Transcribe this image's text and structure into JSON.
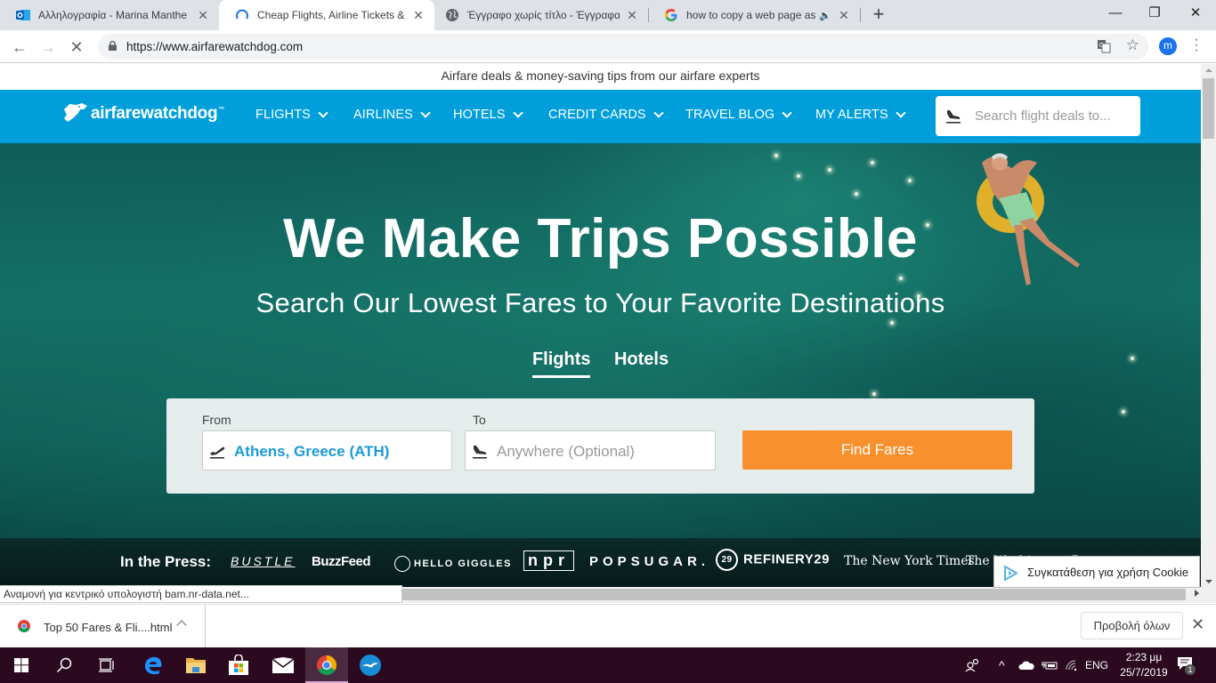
{
  "browser": {
    "tabs": [
      {
        "title": "Αλληλογραφία - Marina Manthe",
        "icon": "outlook-icon",
        "active": false
      },
      {
        "title": "Cheap Flights, Airline Tickets & D",
        "icon": "loading-spinner-icon",
        "active": true
      },
      {
        "title": "Έγγραφο χωρίς τίτλο - Έγγραφα",
        "icon": "globe-icon",
        "active": false
      },
      {
        "title": "how to copy a web page as a",
        "icon": "google-icon",
        "active": false,
        "audio": true
      }
    ],
    "new_tab_label": "+",
    "window_controls": {
      "minimize": "—",
      "restore": "❐",
      "close": "✕"
    },
    "url": "https://www.airfarewatchdog.com",
    "profile_initial": "m",
    "status_text": "Αναμονή για κεντρικό υπολογιστή bam.nr-data.net..."
  },
  "site": {
    "top_banner": "Airfare deals & money-saving tips from our airfare experts",
    "logo_text": "airfarewatchdog",
    "logo_tm": "™",
    "nav": [
      {
        "label": "FLIGHTS"
      },
      {
        "label": "AIRLINES"
      },
      {
        "label": "HOTELS"
      },
      {
        "label": "CREDIT CARDS"
      },
      {
        "label": "TRAVEL BLOG"
      },
      {
        "label": "MY ALERTS"
      }
    ],
    "nav_search_placeholder": "Search flight deals to...",
    "brand_color": "#009fdb",
    "accent_color": "#f7902d"
  },
  "hero": {
    "title": "We Make Trips Possible",
    "subtitle": "Search Our Lowest Fares to Your Favorite Destinations",
    "mode_tabs": [
      {
        "label": "Flights",
        "active": true
      },
      {
        "label": "Hotels",
        "active": false
      }
    ],
    "form": {
      "from_label": "From",
      "from_value": "Athens, Greece (ATH)",
      "to_label": "To",
      "to_placeholder": "Anywhere (Optional)",
      "submit_label": "Find Fares"
    }
  },
  "press": {
    "label": "In the Press:",
    "logos": [
      "BUSTLE",
      "BuzzFeed",
      "HELLO GIGGLES",
      "npr",
      "POPSUGAR.",
      "REFINERY29",
      "The New York Times",
      "The Washington Post"
    ]
  },
  "cookie_notice": "Συγκατάθεση για χρήση Cookie",
  "downloads": {
    "item_name": "Top 50 Fares & Fli....html",
    "show_all_label": "Προβολή όλων"
  },
  "taskbar": {
    "apps": [
      "start",
      "search",
      "task-view",
      "edge",
      "file-explorer",
      "store",
      "mail",
      "chrome",
      "thunderbird"
    ],
    "language": "ENG",
    "time": "2:23 μμ",
    "date": "25/7/2019",
    "notification_count": "1"
  }
}
